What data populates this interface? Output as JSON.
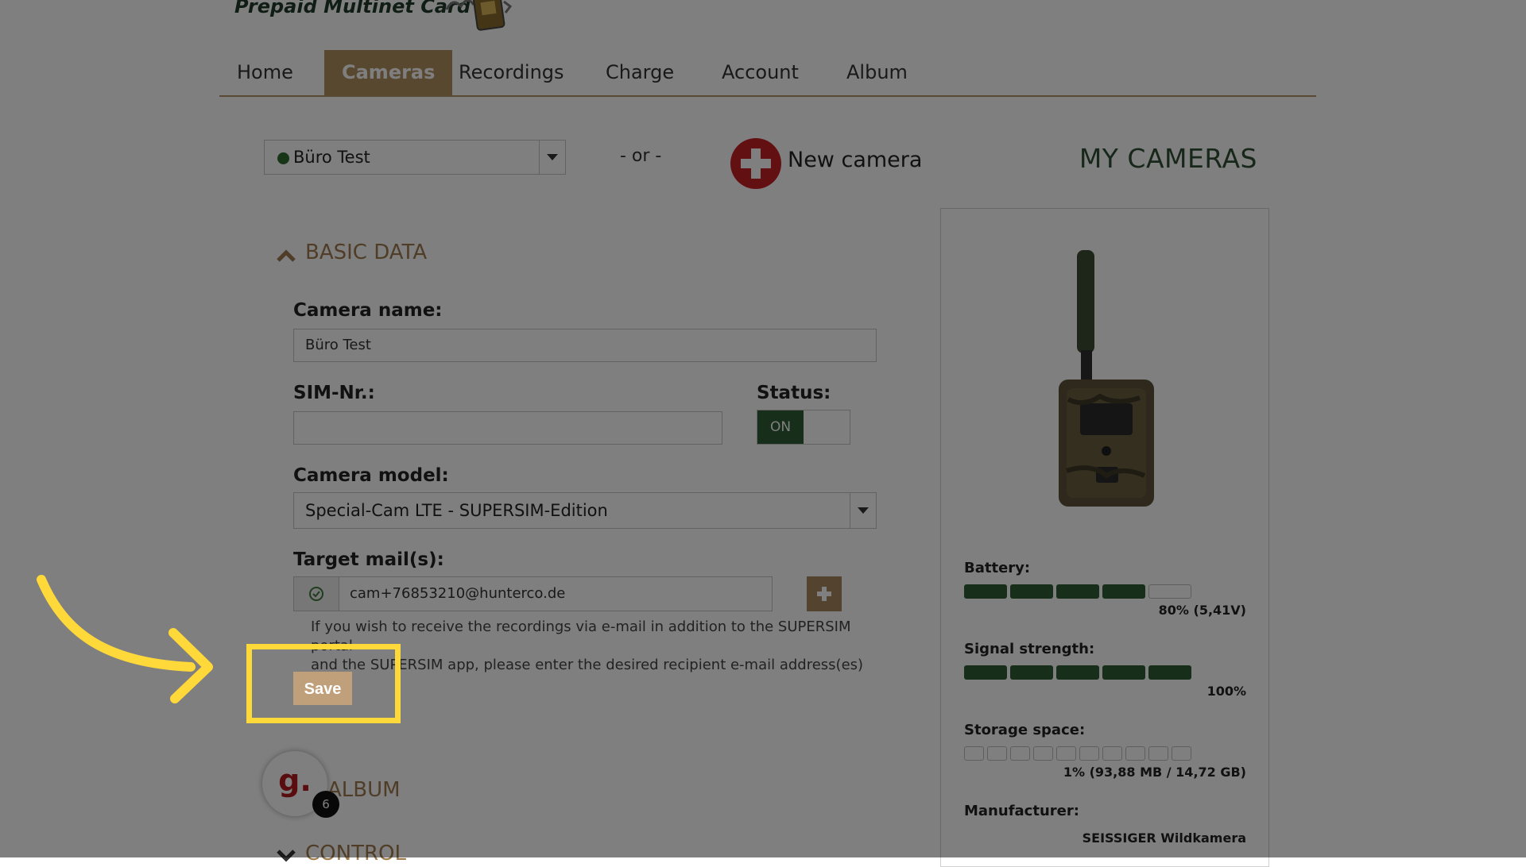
{
  "header": {
    "logo_text": "Prepaid Multinet Card",
    "logo_icon": "sim-card-icon"
  },
  "nav": {
    "items": [
      "Home",
      "Cameras",
      "Recordings",
      "Charge",
      "Account",
      "Album"
    ],
    "active": "Cameras"
  },
  "camera_selector": {
    "selected": "Büro Test",
    "status_color": "#2f6a2f",
    "or_text": "- or -",
    "new_camera_label": "New camera"
  },
  "my_cameras_title": "MY CAMERAS",
  "basic_data": {
    "title": "BASIC DATA",
    "camera_name_label": "Camera name:",
    "camera_name_value": "Büro Test",
    "sim_label": "SIM-Nr.:",
    "sim_value": "",
    "status_label": "Status:",
    "status_value": "ON",
    "camera_model_label": "Camera model:",
    "camera_model_value": "Special-Cam LTE - SUPERSIM-Edition",
    "target_mail_label": "Target mail(s):",
    "target_mail_value": "cam+76853210@hunterco.de",
    "help_line1": "If you wish to receive the recordings via e-mail in addition to the SUPERSIM portal",
    "help_line2": "and the SUPERSIM app, please enter the desired recipient e-mail address(es) here.",
    "save_label": "Save"
  },
  "album": {
    "title": "ALBUM",
    "avatar_letter": "g.",
    "badge_count": "6"
  },
  "control": {
    "title": "CONTROL"
  },
  "camera_panel": {
    "battery_label": "Battery:",
    "battery_value": "80% (5,41V)",
    "battery_fraction": 0.8,
    "signal_label": "Signal strength:",
    "signal_value": "100%",
    "signal_fraction": 1.0,
    "storage_label": "Storage space:",
    "storage_value": "1% (93,88 MB / 14,72 GB)",
    "storage_fraction": 0.01,
    "manufacturer_label": "Manufacturer:",
    "manufacturer_value": "SEISSIGER Wildkamera"
  },
  "colors": {
    "accent": "#b39060",
    "highlight": "#ffd83a",
    "status_green": "#2e5c34",
    "add_red": "#c62026"
  }
}
